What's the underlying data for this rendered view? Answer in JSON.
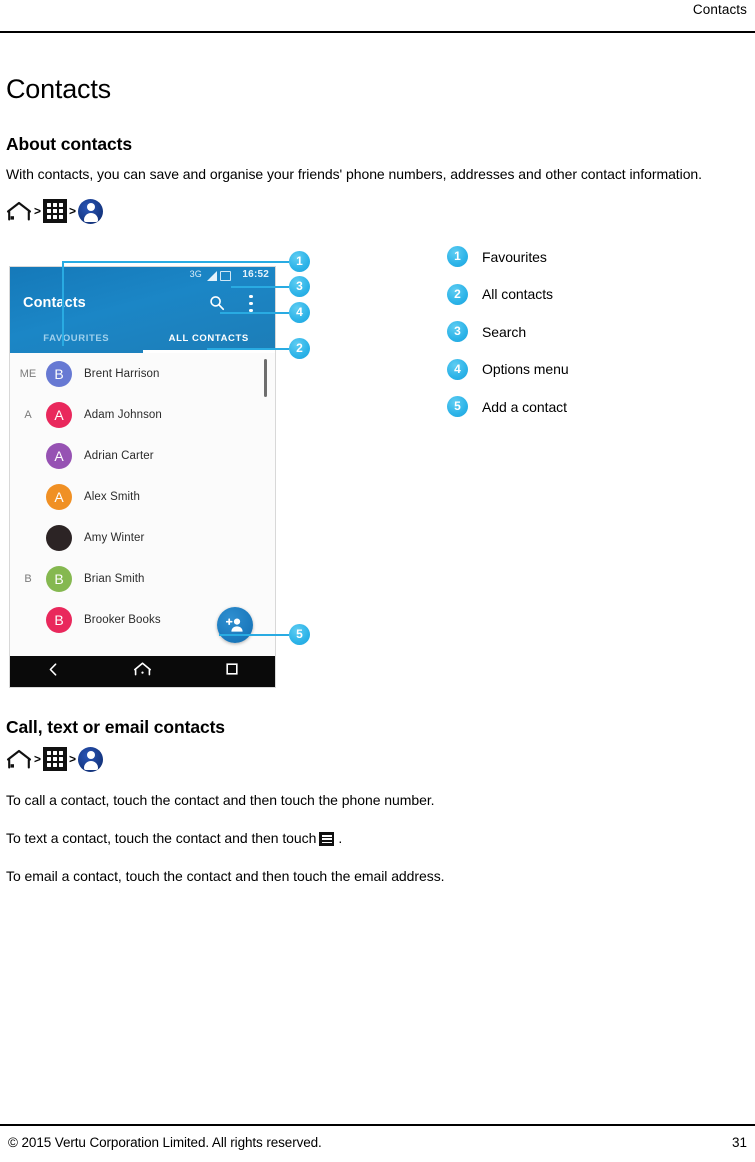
{
  "running_header": {
    "text": "Contacts"
  },
  "page_title": "Contacts",
  "sections": {
    "about": {
      "heading": "About contacts",
      "body": "With contacts, you can save and organise your friends' phone numbers, addresses and other contact information.",
      "breadcrumb": {
        "home_icon": "home-icon",
        "separator": ">",
        "apps_icon": "app-drawer-icon",
        "contacts_icon": "contacts-person-icon"
      }
    },
    "call_text_email": {
      "heading": "Call, text or email contacts",
      "breadcrumb": {
        "home_icon": "home-icon",
        "separator": ">",
        "apps_icon": "app-drawer-icon",
        "contacts_icon": "contacts-person-icon"
      },
      "line_call": "To call a contact, touch the contact and then touch the phone number.",
      "line_text_before": "To text a contact, touch the contact and then touch",
      "line_text_icon": "message-icon",
      "line_text_after": ".",
      "line_email": "To email a contact, touch the contact and then touch the email address."
    }
  },
  "figure": {
    "phone": {
      "status_bar": {
        "network": "3G",
        "signal_icon": "signal-triangle-icon",
        "battery_icon": "battery-icon",
        "time": "16:52"
      },
      "app_bar": {
        "title": "Contacts",
        "search_icon": "search-icon",
        "overflow_icon": "overflow-menu-icon"
      },
      "tabs": [
        {
          "label": "FAVOURITES",
          "active": false
        },
        {
          "label": "ALL CONTACTS",
          "active": true
        }
      ],
      "contacts": [
        {
          "section": "ME",
          "initial": "B",
          "name": "Brent Harrison",
          "color": "#5b6fd0"
        },
        {
          "section": "A",
          "initial": "A",
          "name": "Adam Johnson",
          "color": "#e8174f"
        },
        {
          "section": "",
          "initial": "A",
          "name": "Adrian Carter",
          "color": "#8e44ad"
        },
        {
          "section": "",
          "initial": "A",
          "name": "Alex Smith",
          "color": "#f08712"
        },
        {
          "section": "",
          "initial": "",
          "name": "Amy Winter",
          "color": "#1a1112"
        },
        {
          "section": "B",
          "initial": "B",
          "name": "Brian Smith",
          "color": "#7cb342"
        },
        {
          "section": "",
          "initial": "B",
          "name": "Brooker Books",
          "color": "#e8174f"
        }
      ],
      "fab_icon": "add-contact-icon",
      "nav_bar": {
        "back_icon": "back-icon",
        "home_icon": "home-icon",
        "recents_icon": "recents-icon"
      }
    },
    "callouts": [
      {
        "number": "1",
        "target": "favourites-tab"
      },
      {
        "number": "2",
        "target": "all-contacts-tab"
      },
      {
        "number": "3",
        "target": "search-icon"
      },
      {
        "number": "4",
        "target": "options-menu"
      },
      {
        "number": "5",
        "target": "add-contact-fab"
      }
    ],
    "legend": [
      {
        "number": "1",
        "label": "Favourites"
      },
      {
        "number": "2",
        "label": "All contacts"
      },
      {
        "number": "3",
        "label": "Search"
      },
      {
        "number": "4",
        "label": "Options menu"
      },
      {
        "number": "5",
        "label": "Add a contact"
      }
    ]
  },
  "footer": {
    "copyright": "© 2015 Vertu Corporation Limited. All rights reserved.",
    "page_number": "31"
  },
  "colors": {
    "accent_callout": "#29ABE2",
    "phone_appbar": "#1b86c6",
    "contacts_icon": "#1b3f8f"
  }
}
